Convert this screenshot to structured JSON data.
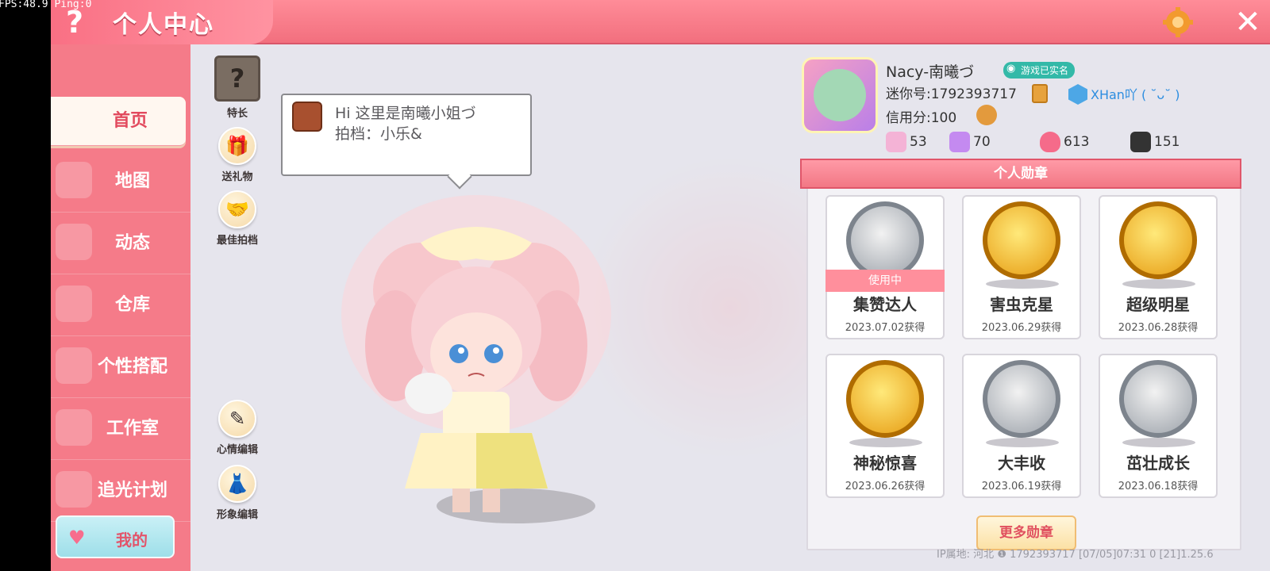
{
  "overlay": {
    "fps": "FPS:48.9  Ping:0"
  },
  "header": {
    "help": "?",
    "title": "个人中心",
    "close": "✕"
  },
  "sidebar": {
    "items": [
      {
        "label": "首页",
        "active": true
      },
      {
        "label": "地图"
      },
      {
        "label": "动态"
      },
      {
        "label": "仓库"
      },
      {
        "label": "个性搭配"
      },
      {
        "label": "工作室"
      },
      {
        "label": "追光计划"
      }
    ],
    "my": "我的"
  },
  "actions": {
    "specialty": "特长",
    "gift": "送礼物",
    "partner": "最佳拍档",
    "mood": "心情编辑",
    "look": "形象编辑"
  },
  "speech": {
    "line1": "Hi   这里是南曦小姐づ",
    "line2": "拍档：小乐&"
  },
  "profile": {
    "name": "Nacy-南曦づ",
    "realname": "游戏已实名",
    "mini_id": "迷你号:1792393717",
    "team": "XHan吖 ( ˘ᴗ˘ )",
    "credit": "信用分:100",
    "stats": [
      "53",
      "70",
      "613",
      "151"
    ]
  },
  "medals": {
    "title": "个人勋章",
    "in_use": "使用中",
    "items": [
      {
        "name": "集赞达人",
        "date": "2023.07.02获得",
        "metal": "silver"
      },
      {
        "name": "害虫克星",
        "date": "2023.06.29获得",
        "metal": "gold"
      },
      {
        "name": "超级明星",
        "date": "2023.06.28获得",
        "metal": "gold"
      },
      {
        "name": "神秘惊喜",
        "date": "2023.06.26获得",
        "metal": "gold"
      },
      {
        "name": "大丰收",
        "date": "2023.06.19获得",
        "metal": "silver"
      },
      {
        "name": "茁壮成长",
        "date": "2023.06.18获得",
        "metal": "silver"
      }
    ],
    "more": "更多勋章"
  },
  "footer": {
    "ip": "IP属地: 河北 ❶      1792393717    [07/05]07:31 0  [21]1.25.6"
  },
  "colors": {
    "accent": "#f26f7e",
    "active_text": "#e24a5e"
  }
}
